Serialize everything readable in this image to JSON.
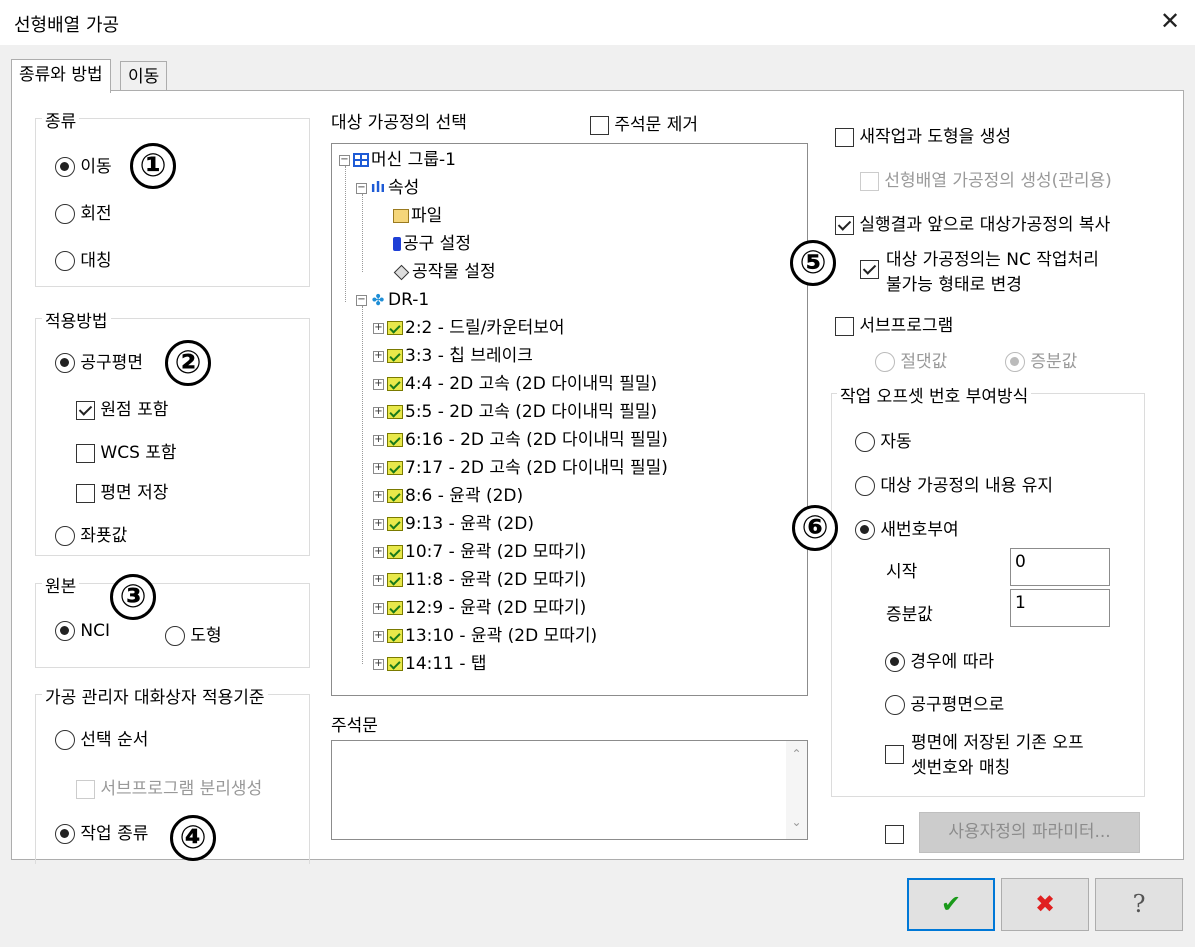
{
  "window": {
    "title": "선형배열 가공",
    "close_glyph": "✕"
  },
  "tabs": [
    {
      "label": "종류와 방법",
      "active": true
    },
    {
      "label": "이동",
      "active": false
    }
  ],
  "type_group": {
    "title": "종류",
    "options": [
      "이동",
      "회전",
      "대칭"
    ],
    "selected": "이동"
  },
  "apply_group": {
    "title": "적용방법",
    "tool_plane": "공구평면",
    "origin_include": "원점 포함",
    "wcs_include": "WCS 포함",
    "plane_save": "평면 저장",
    "coordinates": "좌푯값"
  },
  "source_group": {
    "title": "원본",
    "nci": "NCI",
    "geometry": "도형"
  },
  "manager_group": {
    "title": "가공 관리자 대화상자 적용기준",
    "select_order": "선택 순서",
    "subprogram_separate": "서브프로그램 분리생성",
    "op_type": "작업 종류"
  },
  "badges": [
    "①",
    "②",
    "③",
    "④",
    "⑤",
    "⑥"
  ],
  "target": {
    "title": "대상 가공정의 선택",
    "remove_comments": "주석문 제거",
    "tree": {
      "root": "머신 그룹-1",
      "properties": "속성",
      "files": "파일",
      "tool_settings": "공구 설정",
      "stock_settings": "공작물 설정",
      "group": "DR-1",
      "ops": [
        "2:2 - 드릴/카운터보어",
        "3:3 - 칩 브레이크",
        "4:4 - 2D 고속 (2D 다이내믹 필밀)",
        "5:5 - 2D 고속 (2D 다이내믹 필밀)",
        "6:16 - 2D 고속 (2D 다이내믹 필밀)",
        "7:17 - 2D 고속 (2D 다이내믹 필밀)",
        "8:6 - 윤곽 (2D)",
        "9:13 - 윤곽 (2D)",
        "10:7 - 윤곽 (2D 모따기)",
        "11:8 - 윤곽 (2D 모따기)",
        "12:9 - 윤곽 (2D 모따기)",
        "13:10 - 윤곽 (2D 모따기)",
        "14:11 - 탭"
      ]
    }
  },
  "comments": {
    "label": "주석문",
    "value": ""
  },
  "right": {
    "new_op_geometry": "새작업과 도형을 생성",
    "linear_array_op": "선형배열 가공정의 생성(관리용)",
    "copy_before": "실행결과 앞으로 대상가공정의 복사",
    "nc_disable_line1": "대상 가공정의는 NC 작업처리",
    "nc_disable_line2": "불가능 형태로 변경",
    "subprogram": "서브프로그램",
    "absolute": "절댓값",
    "incremental": "증분값",
    "offset_group": {
      "title": "작업 오프셋 번호 부여방식",
      "auto": "자동",
      "keep": "대상 가공정의 내용 유지",
      "renumber": "새번호부여",
      "start_label": "시작",
      "start_value": "0",
      "increment_label": "증분값",
      "increment_value": "1",
      "by_case": "경우에 따라",
      "by_tool_plane": "공구평면으로",
      "match_line1": "평면에 저장된 기존 오프",
      "match_line2": "셋번호와 매칭"
    },
    "custom_params": "사용자정의 파라미터..."
  },
  "footer": {
    "ok_glyph": "✔",
    "cancel_glyph": "✖",
    "help_glyph": "?"
  },
  "colors": {
    "ok": "#1a9a1a",
    "cancel": "#e02020",
    "tree_blue": "#1e5bd6"
  }
}
